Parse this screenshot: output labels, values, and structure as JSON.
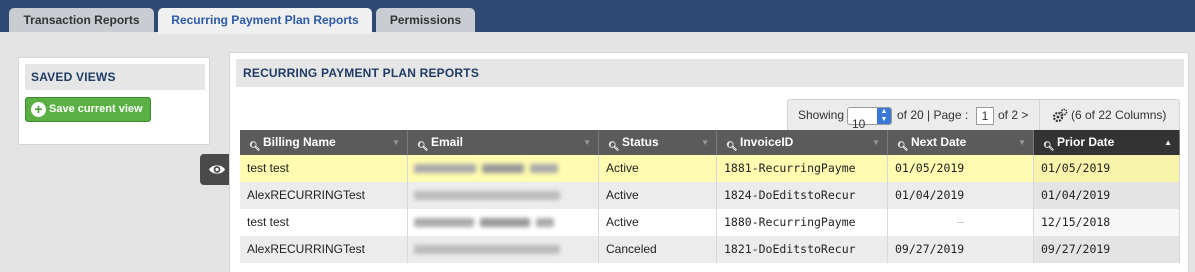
{
  "tabs": [
    {
      "label": "Transaction Reports"
    },
    {
      "label": "Recurring Payment Plan Reports"
    },
    {
      "label": "Permissions"
    }
  ],
  "saved_views": {
    "title": "SAVED VIEWS",
    "save_button": "Save current view"
  },
  "report": {
    "title": "RECURRING PAYMENT PLAN REPORTS",
    "pager": {
      "showing_label": "Showing",
      "page_size": "10",
      "of_label": "of 20 | Page :",
      "page": "1",
      "of_pages": "of 2 >"
    },
    "columns_label": "(6 of 22 Columns)",
    "headers": [
      "Billing Name",
      "Email",
      "Status",
      "InvoiceID",
      "Next Date",
      "Prior Date"
    ],
    "rows": [
      {
        "billing_name": "test test",
        "status": "Active",
        "invoice_id": "1881-RecurringPayme",
        "next_date": "01/05/2019",
        "prior_date": "01/05/2019"
      },
      {
        "billing_name": "AlexRECURRINGTest",
        "status": "Active",
        "invoice_id": "1824-DoEditstoRecur",
        "next_date": "01/04/2019",
        "prior_date": "01/04/2019"
      },
      {
        "billing_name": "test test",
        "status": "Active",
        "invoice_id": "1880-RecurringPayme",
        "next_date": "—",
        "prior_date": "12/15/2018"
      },
      {
        "billing_name": "AlexRECURRINGTest",
        "status": "Canceled",
        "invoice_id": "1821-DoEditstoRecur",
        "next_date": "09/27/2019",
        "prior_date": "09/27/2019"
      }
    ]
  },
  "icons": {
    "eye": "eye-icon",
    "plus": "plus-circle-icon",
    "gear": "gears-icon",
    "search": "search-icon",
    "sort": "sort-icon"
  },
  "colors": {
    "topbar": "#2e4a74",
    "active_tab_text": "#2a5aa8",
    "save_button": "#5ab043",
    "highlight_row": "#fffbb0",
    "header": "#5b5b5b"
  }
}
